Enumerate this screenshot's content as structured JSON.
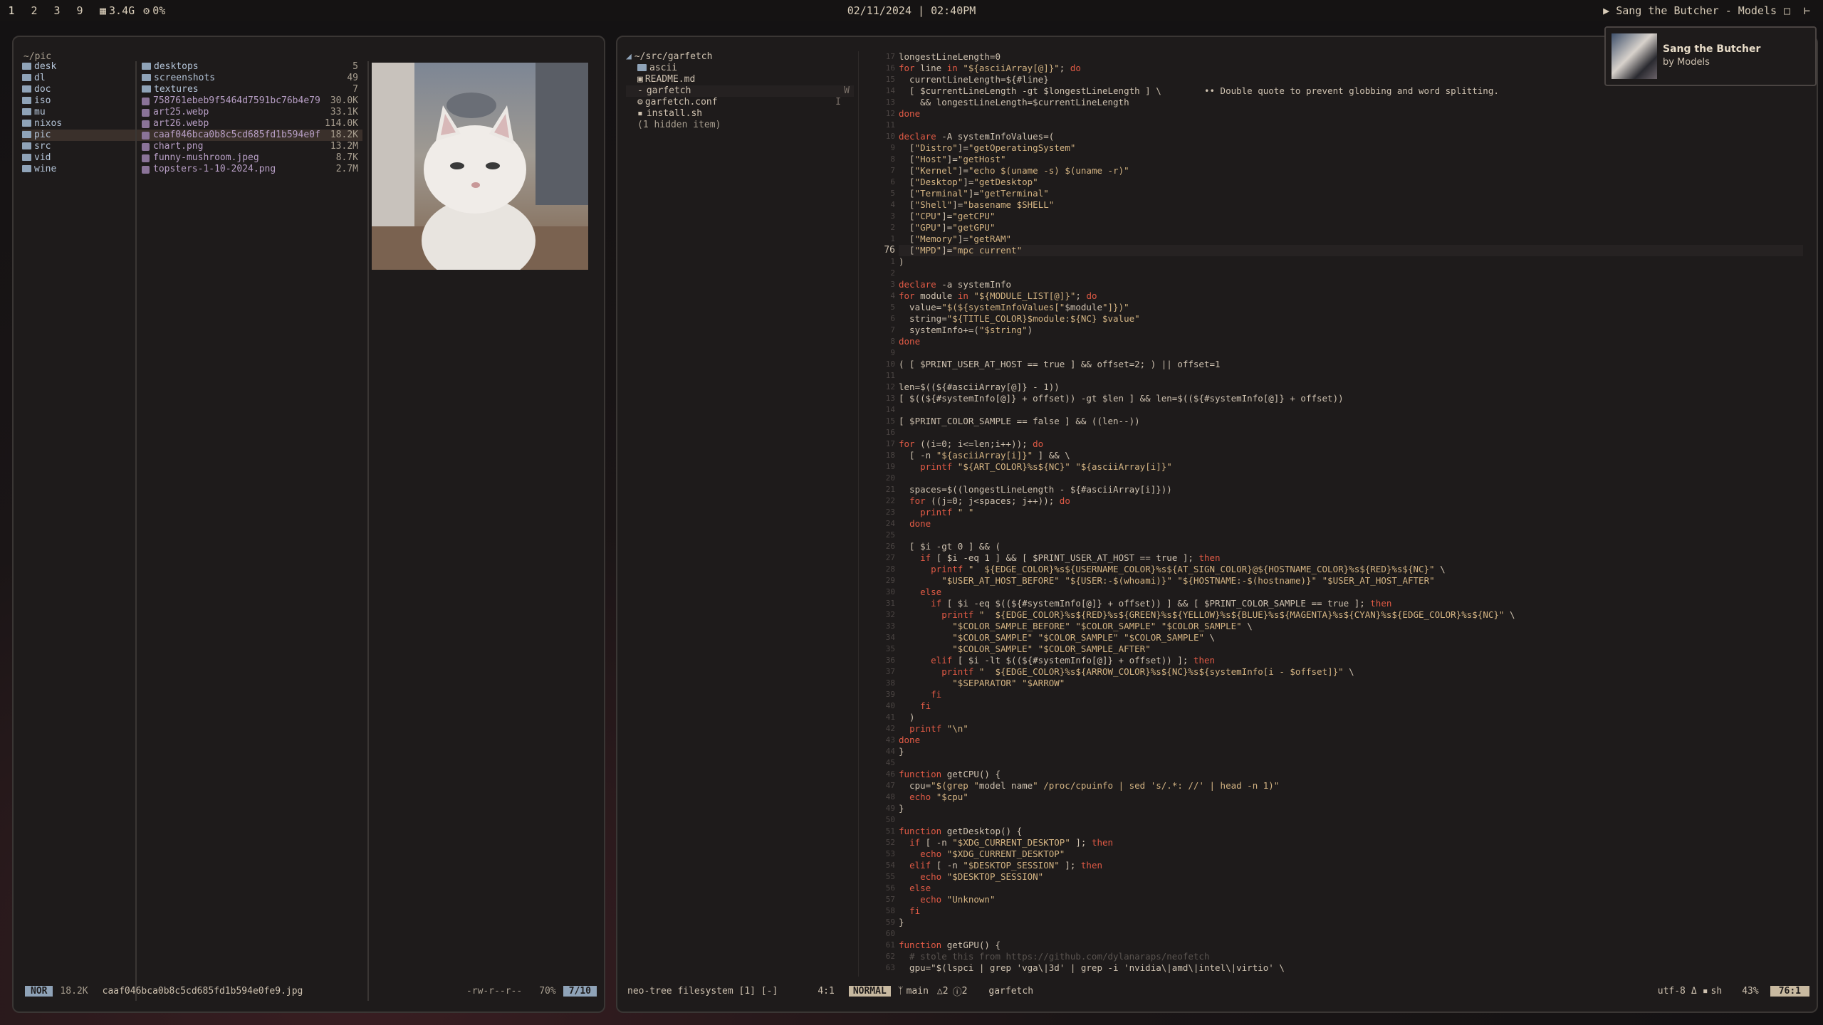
{
  "topbar": {
    "workspaces": [
      "1",
      "2",
      "3",
      "9"
    ],
    "memory": "3.4G",
    "cpu": "0%",
    "datetime": "02/11/2024 | 02:40PM",
    "now_playing": "Sang the Butcher - Models",
    "icons": [
      "memory-icon",
      "cpu-icon",
      "play-icon",
      "window-icon",
      "power-icon"
    ]
  },
  "file_manager": {
    "path": "~/pic",
    "parent_items": [
      {
        "name": "desk"
      },
      {
        "name": "dl"
      },
      {
        "name": "doc"
      },
      {
        "name": "iso"
      },
      {
        "name": "mu"
      },
      {
        "name": "nixos"
      },
      {
        "name": "pic",
        "selected": true
      },
      {
        "name": "src"
      },
      {
        "name": "vid"
      },
      {
        "name": "wine"
      }
    ],
    "current_items": [
      {
        "name": "desktops",
        "size": "5",
        "type": "dir"
      },
      {
        "name": "screenshots",
        "size": "49",
        "type": "dir"
      },
      {
        "name": "textures",
        "size": "7",
        "type": "dir"
      },
      {
        "name": "758761ebeb9f5464d7591bc76b4e79",
        "size": "30.0K",
        "type": "file"
      },
      {
        "name": "art25.webp",
        "size": "33.1K",
        "type": "file"
      },
      {
        "name": "art26.webp",
        "size": "114.0K",
        "type": "file"
      },
      {
        "name": "caaf046bca0b8c5cd685fd1b594e0f",
        "size": "18.2K",
        "type": "file",
        "selected": true
      },
      {
        "name": "chart.png",
        "size": "13.2M",
        "type": "file"
      },
      {
        "name": "funny-mushroom.jpeg",
        "size": "8.7K",
        "type": "file"
      },
      {
        "name": "topsters-1-10-2024.png",
        "size": "2.7M",
        "type": "file"
      }
    ],
    "status": {
      "mode": "NOR",
      "size": "18.2K",
      "filename": "caaf046bca0b8c5cd685fd1b594e0fe9.jpg",
      "perms": "-rw-r--r--",
      "percent": "70%",
      "position": "7/10"
    }
  },
  "editor": {
    "tree": {
      "root": "~/src/garfetch",
      "items": [
        {
          "name": "ascii",
          "icon": "folder-icon"
        },
        {
          "name": "README.md",
          "icon": "markdown-icon"
        },
        {
          "name": "garfetch",
          "icon": "dash-icon",
          "flag": "W"
        },
        {
          "name": "garfetch.conf",
          "icon": "gear-icon",
          "flag": "I"
        },
        {
          "name": "install.sh",
          "icon": "terminal-icon"
        },
        {
          "name": "(1 hidden item)",
          "icon": ""
        }
      ]
    },
    "current_line_number": "76",
    "code_lines": [
      "longestLineLength=0",
      "for line in \"${asciiArray[@]}\"; do",
      "  currentLineLength=${#line}",
      "  [ $currentLineLength -gt $longestLineLength ] \\        •• Double quote to prevent globbing and word splitting.",
      "    && longestLineLength=$currentLineLength",
      "done",
      "",
      "declare -A systemInfoValues=(",
      "  [\"Distro\"]=\"getOperatingSystem\"",
      "  [\"Host\"]=\"getHost\"",
      "  [\"Kernel\"]=\"echo $(uname -s) $(uname -r)\"",
      "  [\"Desktop\"]=\"getDesktop\"",
      "  [\"Terminal\"]=\"getTerminal\"",
      "  [\"Shell\"]=\"basename $SHELL\"",
      "  [\"CPU\"]=\"getCPU\"",
      "  [\"GPU\"]=\"getGPU\"",
      "  [\"Memory\"]=\"getRAM\"",
      "  [\"MPD\"]=\"mpc current\"",
      ")",
      "",
      "declare -a systemInfo",
      "for module in \"${MODULE_LIST[@]}\"; do",
      "  value=\"$(${systemInfoValues[\"$module\"]})\"",
      "  string=\"${TITLE_COLOR}$module:${NC} $value\"",
      "  systemInfo+=(\"$string\")",
      "done",
      "",
      "( [ $PRINT_USER_AT_HOST == true ] && offset=2; ) || offset=1",
      "",
      "len=$((${#asciiArray[@]} - 1))",
      "[ $((${#systemInfo[@]} + offset)) -gt $len ] && len=$((${#systemInfo[@]} + offset))",
      "",
      "[ $PRINT_COLOR_SAMPLE == false ] && ((len--))",
      "",
      "for ((i=0; i<=len;i++)); do",
      "  [ -n \"${asciiArray[i]}\" ] && \\",
      "    printf \"${ART_COLOR}%s${NC}\" \"${asciiArray[i]}\"",
      "",
      "  spaces=$((longestLineLength - ${#asciiArray[i]}))",
      "  for ((j=0; j<spaces; j++)); do",
      "    printf \" \"",
      "  done",
      "",
      "  [ $i -gt 0 ] && (",
      "    if [ $i -eq 1 ] && [ $PRINT_USER_AT_HOST == true ]; then",
      "      printf \"  ${EDGE_COLOR}%s${USERNAME_COLOR}%s${AT_SIGN_COLOR}@${HOSTNAME_COLOR}%s${RED}%s${NC}\" \\",
      "        \"$USER_AT_HOST_BEFORE\" \"${USER:-$(whoami)}\" \"${HOSTNAME:-$(hostname)}\" \"$USER_AT_HOST_AFTER\"",
      "    else",
      "      if [ $i -eq $((${#systemInfo[@]} + offset)) ] && [ $PRINT_COLOR_SAMPLE == true ]; then",
      "        printf \"  ${EDGE_COLOR}%s${RED}%s${GREEN}%s${YELLOW}%s${BLUE}%s${MAGENTA}%s${CYAN}%s${EDGE_COLOR}%s${NC}\" \\",
      "          \"$COLOR_SAMPLE_BEFORE\" \"$COLOR_SAMPLE\" \"$COLOR_SAMPLE\" \\",
      "          \"$COLOR_SAMPLE\" \"$COLOR_SAMPLE\" \"$COLOR_SAMPLE\" \\",
      "          \"$COLOR_SAMPLE\" \"$COLOR_SAMPLE_AFTER\"",
      "      elif [ $i -lt $((${#systemInfo[@]} + offset)) ]; then",
      "        printf \"  ${EDGE_COLOR}%s${ARROW_COLOR}%s${NC}%s${systemInfo[i - $offset]}\" \\",
      "          \"$SEPARATOR\" \"$ARROW\"",
      "      fi",
      "    fi",
      "  )",
      "  printf \"\\n\"",
      "done",
      "}",
      "",
      "function getCPU() {",
      "  cpu=\"$(grep \"model name\" /proc/cpuinfo | sed 's/.*: //' | head -n 1)\"",
      "  echo \"$cpu\"",
      "}",
      "",
      "function getDesktop() {",
      "  if [ -n \"$XDG_CURRENT_DESKTOP\" ]; then",
      "    echo \"$XDG_CURRENT_DESKTOP\"",
      "  elif [ -n \"$DESKTOP_SESSION\" ]; then",
      "    echo \"$DESKTOP_SESSION\"",
      "  else",
      "    echo \"Unknown\"",
      "  fi",
      "}",
      "",
      "function getGPU() {",
      "  # stole this from https://github.com/dylanaraps/neofetch",
      "  gpu=\"$(lspci | grep 'vga\\|3d' | grep -i 'nvidia\\|amd\\|intel\\|virtio' \\"
    ],
    "status": {
      "left": "neo-tree filesystem [1] [-]",
      "left_pos": "4:1",
      "mode": "NORMAL",
      "branch": "main",
      "warnings": "2",
      "hints": "2",
      "file": "garfetch",
      "encoding": "utf-8",
      "filetype": "sh",
      "percent": "43%",
      "position": "76:1"
    }
  },
  "notification": {
    "title": "Sang the Butcher",
    "subtitle": "by Models"
  },
  "colors": {
    "accent_blue": "#8fa3b8",
    "keyword": "#e05a45",
    "string": "#d4b483",
    "mode_badge": "#c8b9a0"
  }
}
